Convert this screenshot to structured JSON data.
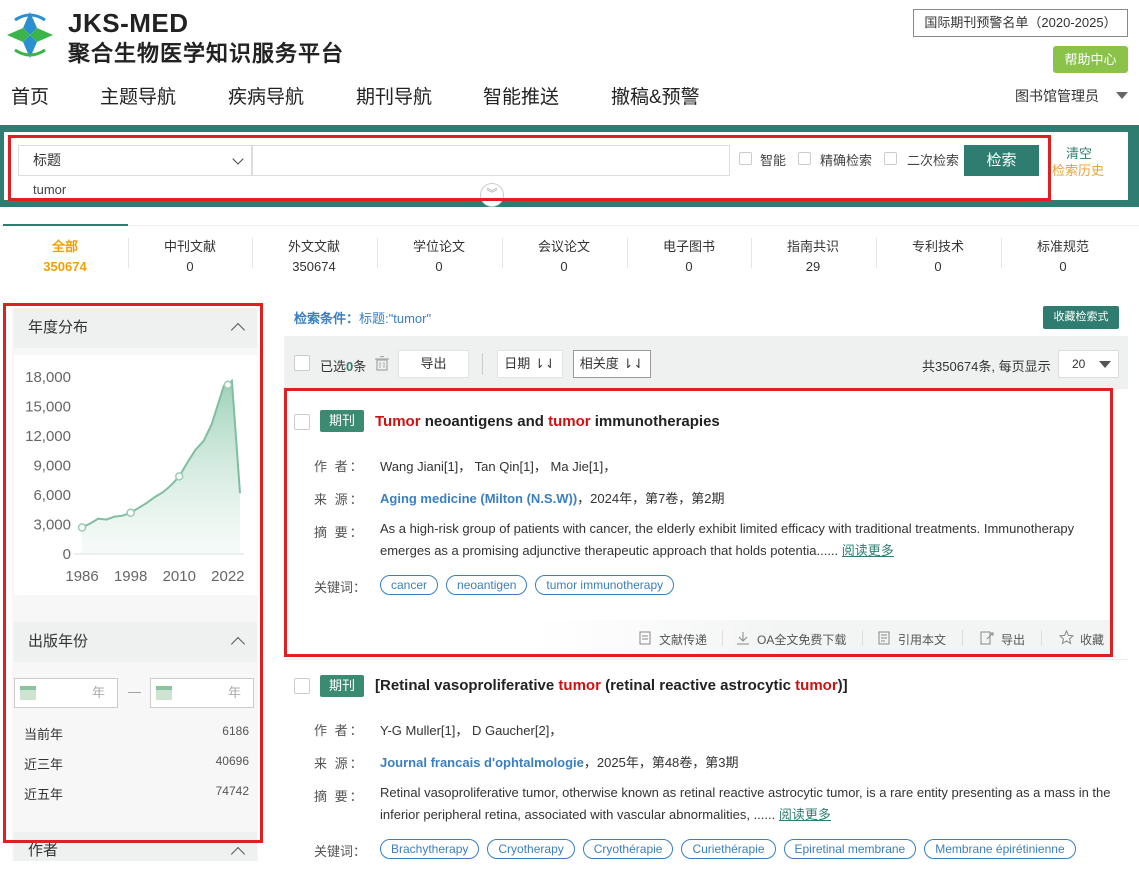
{
  "header": {
    "logo_en": "JKS-MED",
    "logo_cn": "聚合生物医学知识服务平台",
    "warning_list": "国际期刊预警名单（2020-2025）",
    "help": "帮助中心",
    "user": "图书馆管理员"
  },
  "nav": [
    "首页",
    "主题导航",
    "疾病导航",
    "期刊导航",
    "智能推送",
    "撤稿&预警"
  ],
  "search": {
    "field": "标题",
    "query": "tumor",
    "options": [
      "智能",
      "精确检索",
      "二次检索"
    ],
    "button": "检索",
    "clear": "清空",
    "history": "检索历史"
  },
  "tabs": [
    {
      "label": "全部",
      "count": "350674"
    },
    {
      "label": "中刊文献",
      "count": "0"
    },
    {
      "label": "外文文献",
      "count": "350674"
    },
    {
      "label": "学位论文",
      "count": "0"
    },
    {
      "label": "会议论文",
      "count": "0"
    },
    {
      "label": "电子图书",
      "count": "0"
    },
    {
      "label": "指南共识",
      "count": "29"
    },
    {
      "label": "专利技术",
      "count": "0"
    },
    {
      "label": "标准规范",
      "count": "0"
    }
  ],
  "left": {
    "year_dist_title": "年度分布",
    "pub_year_title": "出版年份",
    "year_unit": "年",
    "dash": "—",
    "year_rows": [
      {
        "label": "当前年",
        "value": "6186"
      },
      {
        "label": "近三年",
        "value": "40696"
      },
      {
        "label": "近五年",
        "value": "74742"
      }
    ],
    "author_title": "作者"
  },
  "chart_data": {
    "type": "area",
    "x_ticks": [
      "1986",
      "1998",
      "2010",
      "2022"
    ],
    "y_ticks": [
      "18,000",
      "15,000",
      "12,000",
      "9,000",
      "6,000",
      "3,000",
      "0"
    ],
    "ylim": [
      0,
      18000
    ],
    "xlim": [
      1985,
      2025
    ],
    "x": [
      1986,
      1988,
      1990,
      1992,
      1994,
      1996,
      1998,
      2000,
      2002,
      2004,
      2006,
      2008,
      2010,
      2012,
      2014,
      2016,
      2018,
      2020,
      2021,
      2022,
      2023,
      2024,
      2025
    ],
    "values": [
      2700,
      3100,
      3600,
      3500,
      3800,
      3900,
      4200,
      4700,
      5200,
      5800,
      6300,
      7000,
      7900,
      9300,
      10600,
      11500,
      13200,
      15800,
      17100,
      17200,
      17600,
      12000,
      6186
    ],
    "color": "#8cc9ad"
  },
  "results": {
    "condition_label": "检索条件：",
    "condition_value": "标题:\"tumor\"",
    "save_query": "收藏检索式",
    "selected_prefix": "已选",
    "selected_count": "0",
    "selected_suffix": "条",
    "export": "导出",
    "sort_date": "日期",
    "sort_relevance": "相关度",
    "total": "共350674条, 每页显示",
    "per_page": "20",
    "items": [
      {
        "type": "期刊",
        "title_parts": [
          "Tumor",
          " neoantigens and ",
          "tumor",
          " immunotherapies"
        ],
        "authors": "Wang Jiani[1]，  Tan Qin[1]，  Ma Jie[1]，",
        "source": "Aging medicine (Milton (N.S.W))",
        "source_info": "，2024年，第7卷，第2期",
        "abstract": "As a high-risk group of patients with cancer, the elderly exhibit limited efficacy with traditional treatments. Immunotherapy emerges as a promising adjunctive therapeutic approach that holds potentia......",
        "keywords": [
          "cancer",
          "neoantigen",
          "tumor immunotherapy"
        ],
        "actions": [
          "文献传递",
          "OA全文免费下载",
          "引用本文",
          "导出",
          "收藏"
        ]
      },
      {
        "type": "期刊",
        "title_parts": [
          "[Retinal vasoproliferative ",
          "tumor",
          " (retinal reactive astrocytic ",
          "tumor",
          ")]"
        ],
        "authors": "Y-G Muller[1]，  D Gaucher[2]，",
        "source": "Journal francais d'ophtalmologie",
        "source_info": "，2025年，第48卷，第3期",
        "abstract": "Retinal vasoproliferative tumor, otherwise known as retinal reactive astrocytic tumor, is a rare entity presenting as a mass in the inferior peripheral retina, associated with vascular abnormalities, ......",
        "keywords": [
          "Brachytherapy",
          "Cryotherapy",
          "Cryothérapie",
          "Curiethérapie",
          "Epiretinal membrane",
          "Membrane épirétinienne"
        ]
      }
    ],
    "labels": {
      "authors": "作 者：",
      "source": "来 源：",
      "abstract": "摘 要：",
      "keywords": "关键词：",
      "read_more": "阅读更多"
    }
  }
}
